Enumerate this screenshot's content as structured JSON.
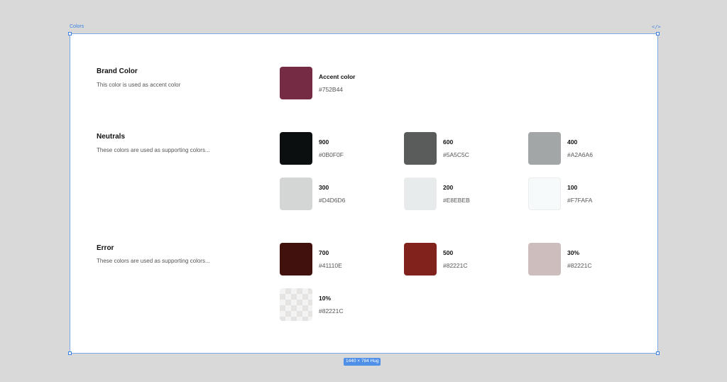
{
  "frame": {
    "label": "Colors",
    "size_badge": "1440 × 784 Hug",
    "code_icon": "</>"
  },
  "sections": {
    "brand": {
      "title": "Brand Color",
      "description": "This color is used as accent color",
      "swatches": [
        {
          "name": "Accent color",
          "hex": "#752B44",
          "color": "#752B44"
        }
      ]
    },
    "neutrals": {
      "title": "Neutrals",
      "description": "These colors are used as supporting colors...",
      "swatches": [
        {
          "name": "900",
          "hex": "#0B0F0F",
          "color": "#0B0F0F"
        },
        {
          "name": "600",
          "hex": "#5A5C5C",
          "color": "#5A5C5C"
        },
        {
          "name": "400",
          "hex": "#A2A6A6",
          "color": "#A2A6A6"
        },
        {
          "name": "300",
          "hex": "#D4D6D6",
          "color": "#D4D6D6"
        },
        {
          "name": "200",
          "hex": "#E8EBEB",
          "color": "#E8EBEB"
        },
        {
          "name": "100",
          "hex": "#F7FAFA",
          "color": "#F7FAFA"
        }
      ]
    },
    "error": {
      "title": "Error",
      "description": "These colors are used as supporting colors...",
      "swatches": [
        {
          "name": "700",
          "hex": "#41110E",
          "color": "#41110E"
        },
        {
          "name": "500",
          "hex": "#82221C",
          "color": "#82221C"
        },
        {
          "name": "30%",
          "hex": "#82221C",
          "color": "#CDBDBD"
        },
        {
          "name": "10%",
          "hex": "#82221C",
          "color": "checker"
        }
      ]
    }
  }
}
